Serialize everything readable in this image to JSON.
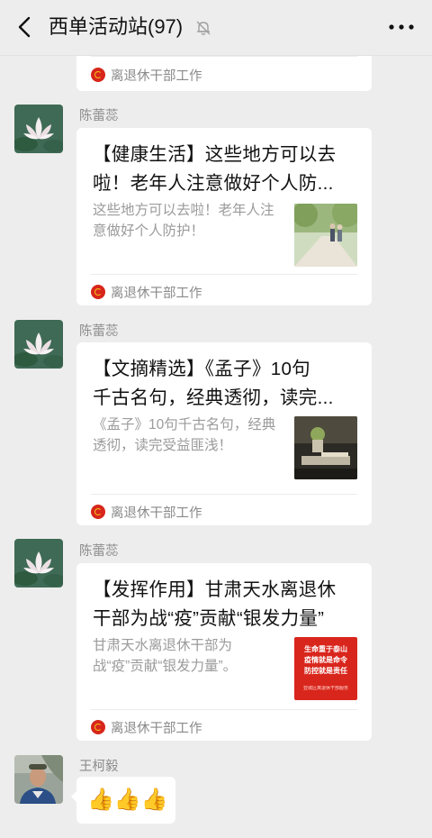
{
  "header": {
    "title": "西单活动站(97)",
    "back_icon": "chevron-left-icon",
    "mute_icon": "bell-off-icon",
    "more_icon": "more-horizontal-icon"
  },
  "messages": [
    {
      "source": "离退休干部工作"
    },
    {
      "sender": "陈蕾蕊",
      "title_line1": "【健康生活】这些地方可以去",
      "title_line2": "啦！老年人注意做好个人防...",
      "desc": "这些地方可以去啦！老年人注意做好个人防护！",
      "source": "离退休干部工作"
    },
    {
      "sender": "陈蕾蕊",
      "title_line1": "【文摘精选】《孟子》10句",
      "title_line2": "千古名句，经典透彻，读完...",
      "desc": "《孟子》10句千古名句，经典透彻，读完受益匪浅！",
      "source": "离退休干部工作"
    },
    {
      "sender": "陈蕾蕊",
      "title_line1": "【发挥作用】甘肃天水离退休",
      "title_line2": "干部为战“疫”贡献“银发力量”",
      "desc": "甘肃天水离退休干部为战“疫”贡献“银发力量”。",
      "source": "离退休干部工作",
      "thumb_text": [
        "生命重于泰山",
        "疫情就是命令",
        "防控就是责任"
      ],
      "thumb_foot": "亚城区离退休干部服务"
    },
    {
      "sender": "王柯毅",
      "text": "👍👍👍"
    }
  ],
  "colors": {
    "background": "#ededed",
    "card": "#ffffff",
    "source_icon": "#d7261b",
    "thumb_red": "#d9261c"
  }
}
